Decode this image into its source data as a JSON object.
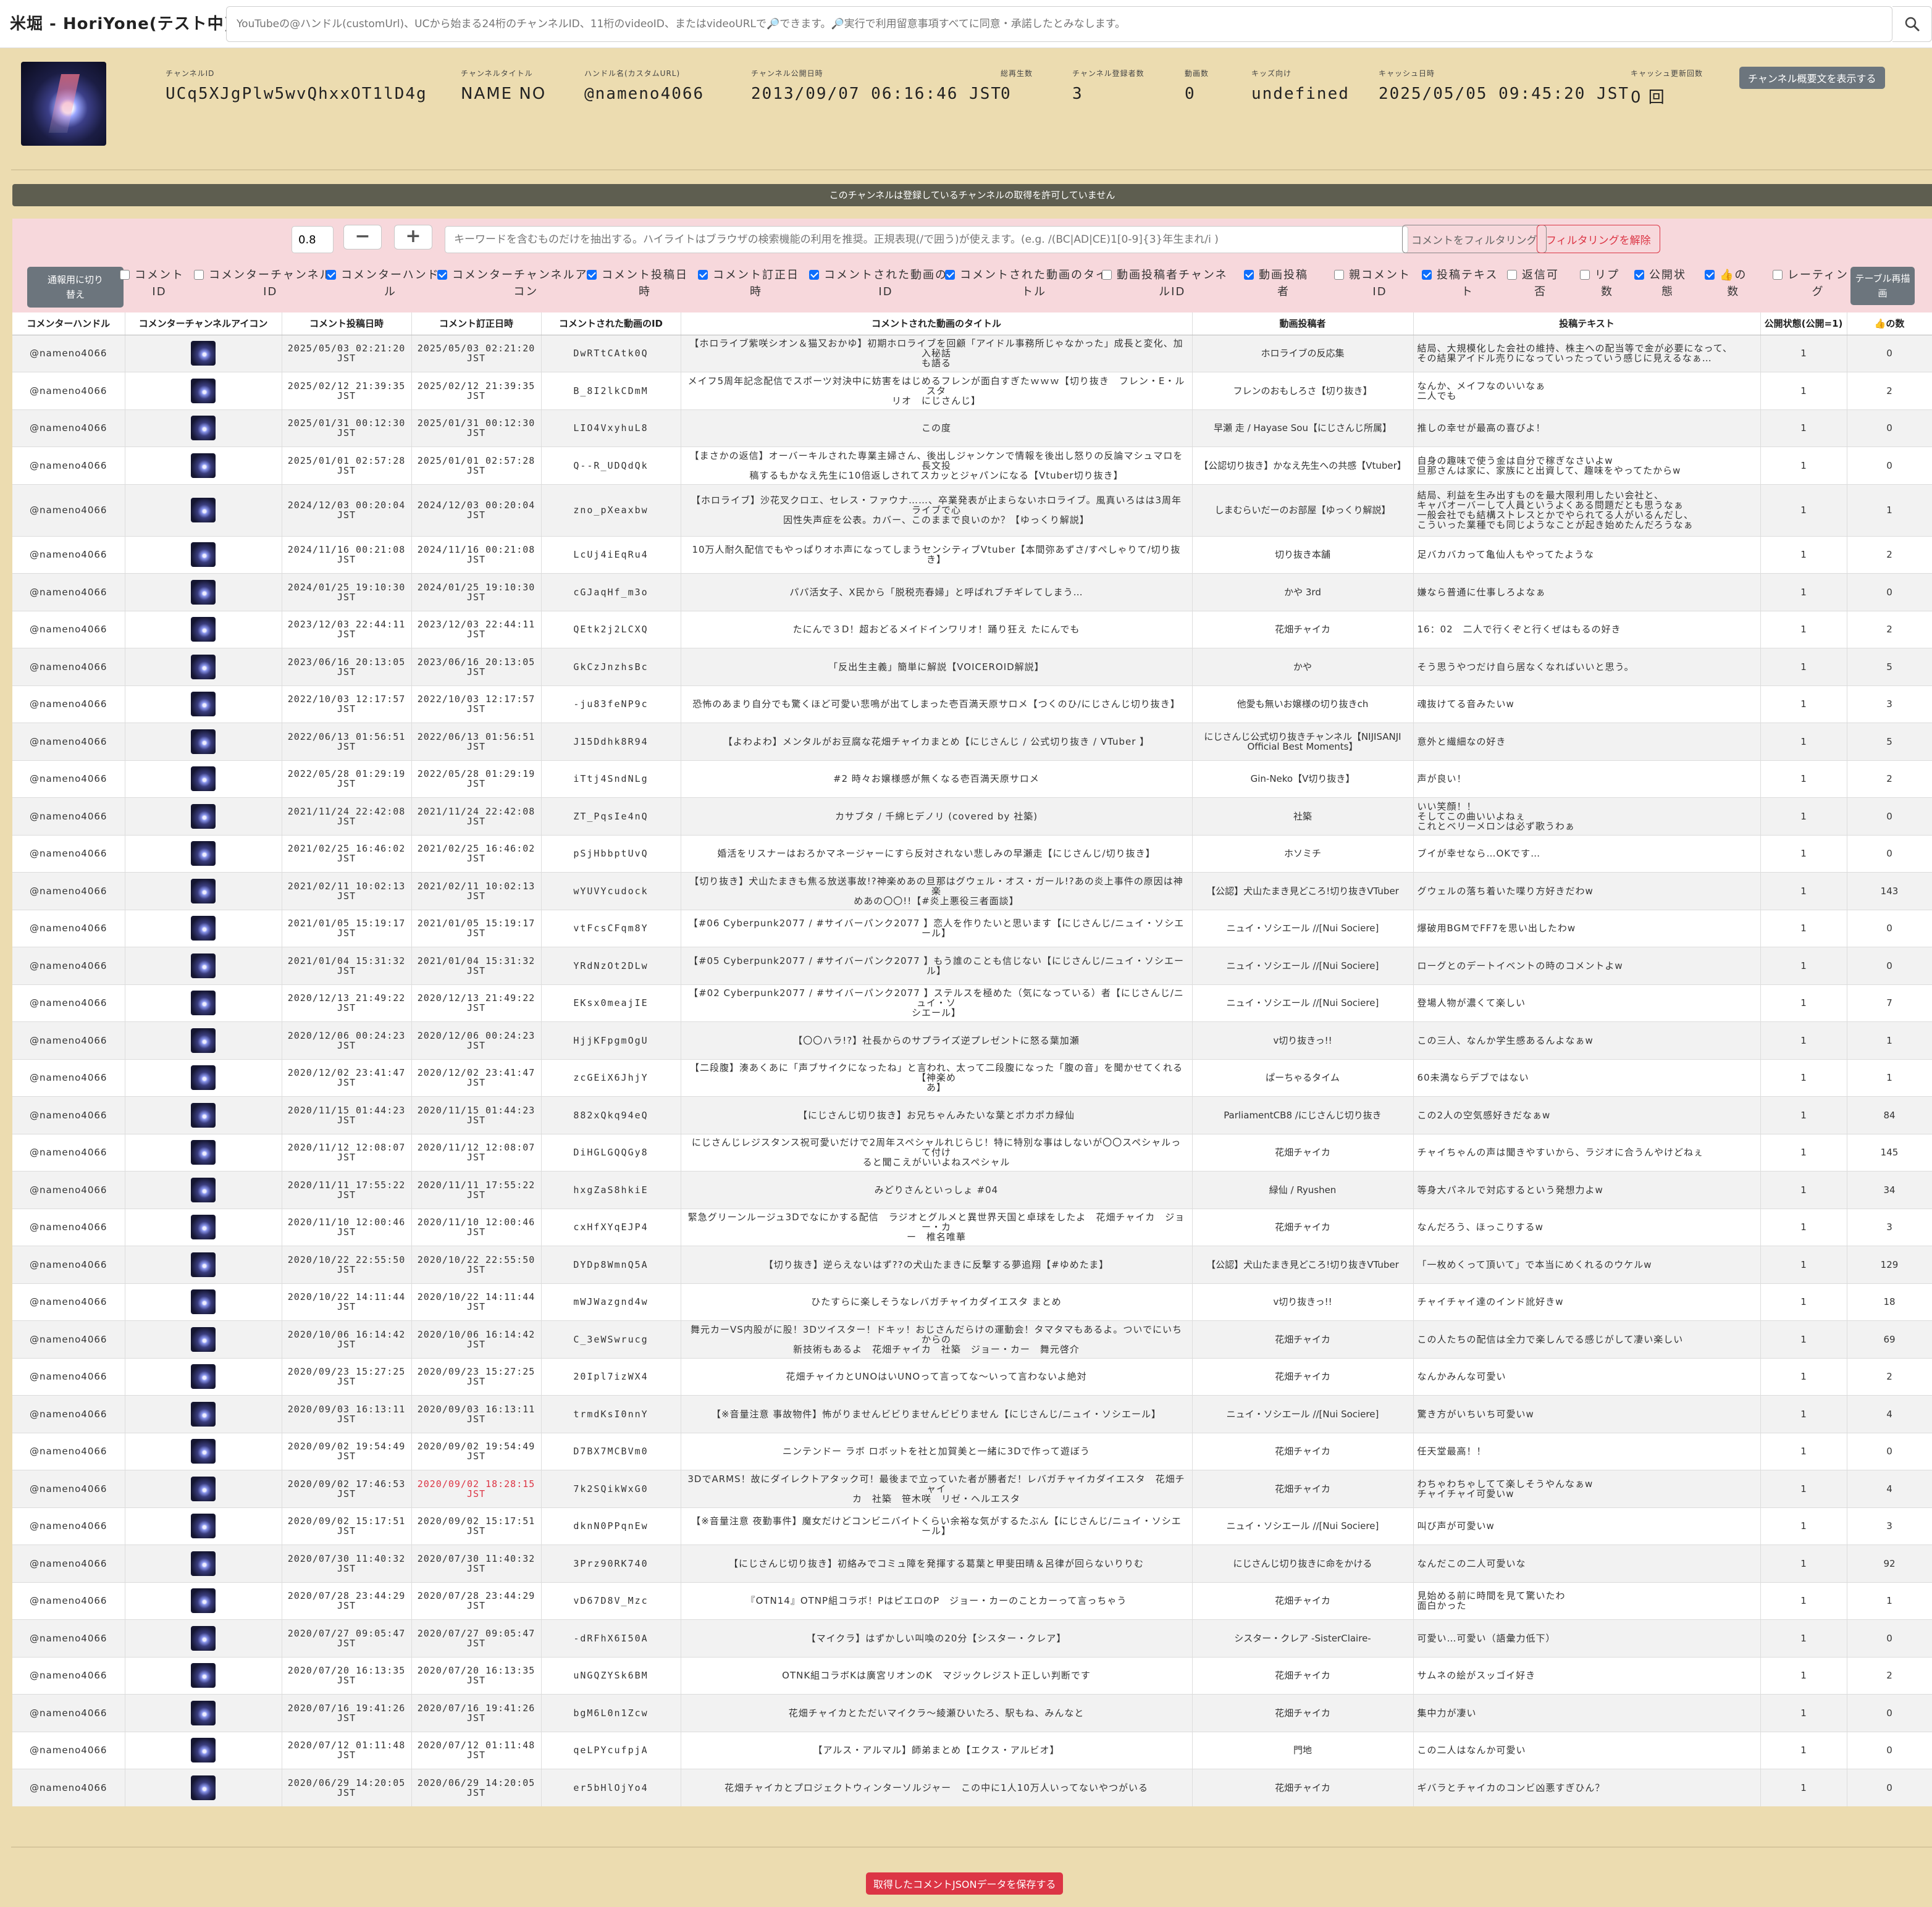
{
  "app": {
    "title": "米堀 - HoriYone(テスト中)"
  },
  "search": {
    "placeholder": "YouTubeの@ハンドル(customUrl)、UCから始まる24桁のチャンネルID、11桁のvideoID、またはvideoURLで🔎できます。🔎実行で利用留意事項すべてに同意・承諾したとみなします。",
    "button_icon": "search-icon"
  },
  "channel": {
    "fields": [
      {
        "label": "チャンネルID",
        "value": "UCq5XJgPlw5wvQhxxOT1lD4g"
      },
      {
        "label": "チャンネルタイトル",
        "value": "NAME NO"
      },
      {
        "label": "ハンドル名(カスタムURL)",
        "value": "@nameno4066"
      },
      {
        "label": "チャンネル公開日時",
        "value": "2013/09/07 06:16:46 JST"
      },
      {
        "label": "総再生数",
        "value": "0"
      },
      {
        "label": "チャンネル登録者数",
        "value": "3"
      },
      {
        "label": "動画数",
        "value": "0"
      },
      {
        "label": "キッズ向け",
        "value": "undefined"
      },
      {
        "label": "キャッシュ日時",
        "value": "2025/05/05 09:45:20 JST"
      },
      {
        "label": "キャッシュ更新回数",
        "value": "0 回"
      }
    ],
    "desc_button": "チャンネル概要文を表示する"
  },
  "notice": "このチャンネルは登録しているチャンネルの取得を許可していません",
  "filter": {
    "zoom_value": "0.8",
    "minus": "−",
    "plus": "+",
    "keyword_placeholder": "キーワードを含むものだけを抽出する。ハイライトはブラウザの検索機能の利用を推奨。正規表現(/で囲う)が使えます。(e.g. /(BC|AD|CE)1[0-9]{3}年生まれ/i )",
    "filter_button": "コメントをフィルタリング",
    "clear_button": "フィルタリングを解除",
    "toggle_button": "通報用に切り\n替え",
    "redraw_button": "テーブル再描\n画",
    "columns": [
      {
        "label": "コメント\nID",
        "checked": false
      },
      {
        "label": "コメンターチャンネル\nID",
        "checked": false
      },
      {
        "label": "コメンターハンド\nル",
        "checked": true
      },
      {
        "label": "コメンターチャンネルアイ\nコン",
        "checked": true
      },
      {
        "label": "コメント投稿日\n時",
        "checked": true
      },
      {
        "label": "コメント訂正日\n時",
        "checked": true
      },
      {
        "label": "コメントされた動画の\nID",
        "checked": true
      },
      {
        "label": "コメントされた動画のタイ\nトル",
        "checked": true
      },
      {
        "label": "動画投稿者チャンネ\nルID",
        "checked": false
      },
      {
        "label": "動画投稿\n者",
        "checked": true
      },
      {
        "label": "親コメント\nID",
        "checked": false
      },
      {
        "label": "投稿テキス\nト",
        "checked": true
      },
      {
        "label": "返信可\n否",
        "checked": false
      },
      {
        "label": "リプ\n数",
        "checked": false
      },
      {
        "label": "公開状\n態",
        "checked": true
      },
      {
        "label": "👍の\n数",
        "checked": true
      },
      {
        "label": "レーティン\nグ",
        "checked": false
      }
    ]
  },
  "table": {
    "headers": [
      "コメンターハンドル",
      "コメンターチャンネルアイコン",
      "コメント投稿日時",
      "コメント訂正日時",
      "コメントされた動画のID",
      "コメントされた動画のタイトル",
      "動画投稿者",
      "投稿テキスト",
      "公開状態(公開=1)",
      "👍の数"
    ],
    "handle": "@nameno4066",
    "rows": [
      {
        "posted": "2025/05/03 02:21:20\nJST",
        "edited": "2025/05/03 02:21:20\nJST",
        "vid": "DwRTtCAtk0Q",
        "title": "【ホロライブ紫咲シオン＆猫又おかゆ】初期ホロライブを回顧「アイドル事務所じゃなかった」成長と変化、加入秘話\nも語る",
        "uploader": "ホロライブの反応集",
        "text": "結局、大規模化した会社の維持、株主への配当等で金が必要になって、\nその結果アイドル売りになっていったっていう感じに見えるなぁ…",
        "status": "1",
        "likes": "0"
      },
      {
        "posted": "2025/02/12 21:39:35\nJST",
        "edited": "2025/02/12 21:39:35\nJST",
        "vid": "B_8I2lkCDmM",
        "title": "メイフ5周年記念配信でスポーツ対決中に妨害をはじめるフレンが面白すぎたｗｗｗ【切り抜き　フレン・E・ルスタ\nリオ　にじさんじ】",
        "uploader": "フレンのおもしろさ【切り抜き】",
        "text": "なんか、メイフなのいいなぁ\n二人でも",
        "status": "1",
        "likes": "2"
      },
      {
        "posted": "2025/01/31 00:12:30\nJST",
        "edited": "2025/01/31 00:12:30\nJST",
        "vid": "LIO4VxyhuL8",
        "title": "この度",
        "uploader": "早瀬 走 / Hayase Sou【にじさんじ所属】",
        "text": "推しの幸せが最高の喜びよ！",
        "status": "1",
        "likes": "0"
      },
      {
        "posted": "2025/01/01 02:57:28\nJST",
        "edited": "2025/01/01 02:57:28\nJST",
        "vid": "Q--R_UDQdQk",
        "title": "【まさかの返信】オーバーキルされた専業主婦さん、後出しジャンケンで情報を後出し怒りの反論マシュマロを長文投\n稿するもかなえ先生に10倍返しされてスカッとジャパンになる【Vtuber切り抜き】",
        "uploader": "【公認切り抜き】かなえ先生への共感【Vtuber】",
        "text": "自身の趣味で使う金は自分で稼ぎなさいよw\n旦那さんは家に、家族にと出資して、趣味をやってたからw",
        "status": "1",
        "likes": "0"
      },
      {
        "posted": "2024/12/03 00:20:04\nJST",
        "edited": "2024/12/03 00:20:04\nJST",
        "vid": "zno_pXeaxbw",
        "title": "【ホロライブ】沙花叉クロエ、セレス・ファウナ……、卒業発表が止まらないホロライブ。風真いろはは3周年ライブで心\n因性失声症を公表。カバー、このままで良いのか？【ゆっくり解説】",
        "uploader": "しまむらいだーのお部屋【ゆっくり解説】",
        "text": "結局、利益を生み出すものを最大限利用したい会社と、\nキャパオーバーして人員というよくある問題だとも思うなぁ\n一般会社でも結構ストレスとかでやられてる人がいるんだし、\nこういった業種でも同じようなことが起き始めたんだろうなぁ",
        "status": "1",
        "likes": "1"
      },
      {
        "posted": "2024/11/16 00:21:08\nJST",
        "edited": "2024/11/16 00:21:08\nJST",
        "vid": "LcUj4iEqRu4",
        "title": "10万人耐久配信でもやっぱりオホ声になってしまうセンシティブVtuber【本間弥あずさ/すぺしゃりて/切り抜き】",
        "uploader": "切り抜き本舗",
        "text": "足バカバカって亀仙人もやってたような",
        "status": "1",
        "likes": "2"
      },
      {
        "posted": "2024/01/25 19:10:30\nJST",
        "edited": "2024/01/25 19:10:30\nJST",
        "vid": "cGJaqHf_m3o",
        "title": "パパ活女子、X民から「脱税売春婦」と呼ばれブチギレてしまう…",
        "uploader": "かや 3rd",
        "text": "嫌なら普通に仕事しろよなぁ",
        "status": "1",
        "likes": "0"
      },
      {
        "posted": "2023/12/03 22:44:11\nJST",
        "edited": "2023/12/03 22:44:11\nJST",
        "vid": "QEtk2j2LCXQ",
        "title": "たにんで３D！超おどるメイドインワリオ！踊り狂え たにんでも",
        "uploader": "花畑チャイカ",
        "text": "16：02　二人で行くぞと行くぜはもるの好き",
        "status": "1",
        "likes": "2"
      },
      {
        "posted": "2023/06/16 20:13:05\nJST",
        "edited": "2023/06/16 20:13:05\nJST",
        "vid": "GkCzJnzhsBc",
        "title": "「反出生主義」簡単に解説【VOICEROID解説】",
        "uploader": "かや",
        "text": "そう思うやつだけ自ら居なくなればいいと思う。",
        "status": "1",
        "likes": "5"
      },
      {
        "posted": "2022/10/03 12:17:57\nJST",
        "edited": "2022/10/03 12:17:57\nJST",
        "vid": "-ju83feNP9c",
        "title": "恐怖のあまり自分でも驚くほど可愛い悲鳴が出てしまった壱百満天原サロメ【つくのひ/にじさんじ切り抜き】",
        "uploader": "他愛も無いお嬢様の切り抜きch",
        "text": "魂抜けてる音みたいw",
        "status": "1",
        "likes": "3"
      },
      {
        "posted": "2022/06/13 01:56:51\nJST",
        "edited": "2022/06/13 01:56:51\nJST",
        "vid": "J15Ddhk8R94",
        "title": "【よわよわ】メンタルがお豆腐な花畑チャイカまとめ【にじさんじ / 公式切り抜き / VTuber 】",
        "uploader": "にじさんじ公式切り抜きチャンネル【NIJISANJI\nOfficial Best Moments】",
        "text": "意外と繊細なの好き",
        "status": "1",
        "likes": "5"
      },
      {
        "posted": "2022/05/28 01:29:19\nJST",
        "edited": "2022/05/28 01:29:19\nJST",
        "vid": "iTtj4SndNLg",
        "title": "#2 時々お嬢様感が無くなる壱百満天原サロメ",
        "uploader": "Gin-Neko【V切り抜き】",
        "text": "声が良い！",
        "status": "1",
        "likes": "2"
      },
      {
        "posted": "2021/11/24 22:42:08\nJST",
        "edited": "2021/11/24 22:42:08\nJST",
        "vid": "ZT_PqsIe4nQ",
        "title": "カサブタ / 千綿ヒデノリ (covered by 社築)",
        "uploader": "社築",
        "text": "いい笑顔！！\nそしてこの曲いいよねぇ\nこれとベリーメロンは必ず歌うわぁ",
        "status": "1",
        "likes": "0"
      },
      {
        "posted": "2021/02/25 16:46:02\nJST",
        "edited": "2021/02/25 16:46:02\nJST",
        "vid": "pSjHbbptUvQ",
        "title": "婚活をリスナーはおろかマネージャーにすら反対されない悲しみの早瀬走【にじさんじ/切り抜き】",
        "uploader": "ホソミチ",
        "text": "ブイが幸せなら…OKです…",
        "status": "1",
        "likes": "0"
      },
      {
        "posted": "2021/02/11 10:02:13\nJST",
        "edited": "2021/02/11 10:02:13\nJST",
        "vid": "wYUVYcudock",
        "title": "【切り抜き】犬山たまきも焦る放送事故!?神楽めあの旦那はグウェル・オス・ガール!?あの炎上事件の原因は神楽\nめあの〇〇!!【#炎上悪役三者面談】",
        "uploader": "【公認】犬山たまき見どころ!切り抜きVTuber",
        "text": "グウェルの落ち着いた喋り方好きだわw",
        "status": "1",
        "likes": "143"
      },
      {
        "posted": "2021/01/05 15:19:17\nJST",
        "edited": "2021/01/05 15:19:17\nJST",
        "vid": "vtFcsCFqm8Y",
        "title": "【#06 Cyberpunk2077 / #サイバーパンク2077 】恋人を作りたいと思います【にじさんじ/ニュイ・ソシエール】",
        "uploader": "ニュイ・ソシエール //[Nui Sociere]",
        "text": "爆破用BGMでFF7を思い出したわw",
        "status": "1",
        "likes": "0"
      },
      {
        "posted": "2021/01/04 15:31:32\nJST",
        "edited": "2021/01/04 15:31:32\nJST",
        "vid": "YRdNzOt2DLw",
        "title": "【#05 Cyberpunk2077 / #サイバーパンク2077 】もう誰のことも信じない【にじさんじ/ニュイ・ソシエール】",
        "uploader": "ニュイ・ソシエール //[Nui Sociere]",
        "text": "ローグとのデートイベントの時のコメントよw",
        "status": "1",
        "likes": "0"
      },
      {
        "posted": "2020/12/13 21:49:22\nJST",
        "edited": "2020/12/13 21:49:22\nJST",
        "vid": "EKsx0meajIE",
        "title": "【#02 Cyberpunk2077 / #サイバーパンク2077 】ステルスを極めた（気になっている）者【にじさんじ/ニュイ・ソ\nシエール】",
        "uploader": "ニュイ・ソシエール //[Nui Sociere]",
        "text": "登場人物が濃くて楽しい",
        "status": "1",
        "likes": "7"
      },
      {
        "posted": "2020/12/06 00:24:23\nJST",
        "edited": "2020/12/06 00:24:23\nJST",
        "vid": "HjjKFpgmOgU",
        "title": "【〇〇ハラ!?】社長からのサプライズ逆プレゼントに怒る葉加瀬",
        "uploader": "v切り抜きっ!!",
        "text": "この三人、なんか学生感あるんよなぁw",
        "status": "1",
        "likes": "1"
      },
      {
        "posted": "2020/12/02 23:41:47\nJST",
        "edited": "2020/12/02 23:41:47\nJST",
        "vid": "zcGEiX6JhjY",
        "title": "【二段腹】湊あくあに「声ブサイクになったね」と言われ、太って二段腹になった「腹の音」を聞かせてくれる【神楽め\nあ】",
        "uploader": "ぱーちゃるタイム",
        "text": "60未満ならデブではない",
        "status": "1",
        "likes": "1"
      },
      {
        "posted": "2020/11/15 01:44:23\nJST",
        "edited": "2020/11/15 01:44:23\nJST",
        "vid": "882xQkq94eQ",
        "title": "【にじさんじ切り抜き】お兄ちゃんみたいな葉とポカポカ緑仙",
        "uploader": "ParliamentCB8 /にじさんじ切り抜き",
        "text": "この2人の空気感好きだなぁw",
        "status": "1",
        "likes": "84"
      },
      {
        "posted": "2020/11/12 12:08:07\nJST",
        "edited": "2020/11/12 12:08:07\nJST",
        "vid": "DiHGLGQQGy8",
        "title": "にじさんじレジスタンス祝可愛いだけで2周年スペシャルれじらじ！特に特別な事はしないが〇〇スペシャルって付け\nると聞こえがいいよねスペシャル",
        "uploader": "花畑チャイカ",
        "text": "チャイちゃんの声は聞きやすいから、ラジオに合うんやけどねぇ",
        "status": "1",
        "likes": "145"
      },
      {
        "posted": "2020/11/11 17:55:22\nJST",
        "edited": "2020/11/11 17:55:22\nJST",
        "vid": "hxgZaS8hkiE",
        "title": "みどりさんといっしょ #04",
        "uploader": "緑仙 / Ryushen",
        "text": "等身大パネルで対応するという発想力よw",
        "status": "1",
        "likes": "34"
      },
      {
        "posted": "2020/11/10 12:00:46\nJST",
        "edited": "2020/11/10 12:00:46\nJST",
        "vid": "cxHfXYqEJP4",
        "title": "緊急グリーンルージュ3Dでなにかする配信　ラジオとグルメと異世界天国と卓球をしたよ　花畑チャイカ　ジョー・カ\nー　椎名唯華",
        "uploader": "花畑チャイカ",
        "text": "なんだろう、ほっこりするw",
        "status": "1",
        "likes": "3"
      },
      {
        "posted": "2020/10/22 22:55:50\nJST",
        "edited": "2020/10/22 22:55:50\nJST",
        "vid": "DYDp8WmnQ5A",
        "title": "【切り抜き】逆らえないはず??の犬山たまきに反撃する夢追翔【#ゆめたま】",
        "uploader": "【公認】犬山たまき見どころ!切り抜きVTuber",
        "text": "「一枚めくって頂いて」で本当にめくれるのウケルw",
        "status": "1",
        "likes": "129"
      },
      {
        "posted": "2020/10/22 14:11:44\nJST",
        "edited": "2020/10/22 14:11:44\nJST",
        "vid": "mWJWazgnd4w",
        "title": "ひたすらに楽しそうなレバガチャイカダイエスタ まとめ",
        "uploader": "v切り抜きっ!!",
        "text": "チャイチャイ達のインド訛好きw",
        "status": "1",
        "likes": "18"
      },
      {
        "posted": "2020/10/06 16:14:42\nJST",
        "edited": "2020/10/06 16:14:42\nJST",
        "vid": "C_3eWSwrucg",
        "title": "舞元カーVS内股がに股！3Dツイスター！ドキッ！おじさんだらけの運動会！タマタマもあるよ。ついでにいちからの\n新技術もあるよ　花畑チャイカ　社築　ジョー・カー　舞元啓介",
        "uploader": "花畑チャイカ",
        "text": "この人たちの配信は全力で楽しんでる感じがして凄い楽しい",
        "status": "1",
        "likes": "69"
      },
      {
        "posted": "2020/09/23 15:27:25\nJST",
        "edited": "2020/09/23 15:27:25\nJST",
        "vid": "20Ipl7izWX4",
        "title": "花畑チャイカとUNOはいUNOって言ってな～いって言わないよ絶対",
        "uploader": "花畑チャイカ",
        "text": "なんかみんな可愛い",
        "status": "1",
        "likes": "2"
      },
      {
        "posted": "2020/09/03 16:13:11\nJST",
        "edited": "2020/09/03 16:13:11\nJST",
        "vid": "trmdKsI0nnY",
        "title": "【※音量注意 事故物件】怖がりませんビビりませんビビりません【にじさんじ/ニュイ・ソシエール】",
        "uploader": "ニュイ・ソシエール //[Nui Sociere]",
        "text": "驚き方がいちいち可愛いw",
        "status": "1",
        "likes": "4"
      },
      {
        "posted": "2020/09/02 19:54:49\nJST",
        "edited": "2020/09/02 19:54:49\nJST",
        "vid": "D7BX7MCBVm0",
        "title": "ニンテンドー ラボ ロボットを社と加賀美と一緒に3Dで作って遊ぼう",
        "uploader": "花畑チャイカ",
        "text": "任天堂最高！！",
        "status": "1",
        "likes": "0"
      },
      {
        "posted": "2020/09/02 17:46:53\nJST",
        "edited": "2020/09/02 18:28:15\nJST",
        "edited_red": true,
        "vid": "7k2SQikWxG0",
        "title": "3DでARMS！故にダイレクトアタック可！最後まで立っていた者が勝者だ！レバガチャイカダイエスタ　花畑チャイ\nカ　社築　笹木咲　リゼ・ヘルエスタ",
        "uploader": "花畑チャイカ",
        "text": "わちゃわちゃしてて楽しそうやんなぁw\nチャイチャイ可愛いw",
        "status": "1",
        "likes": "4"
      },
      {
        "posted": "2020/09/02 15:17:51\nJST",
        "edited": "2020/09/02 15:17:51\nJST",
        "vid": "dknN0PPqnEw",
        "title": "【※音量注意 夜勤事件】魔女だけどコンビニバイトくらい余裕な気がするたぶん【にじさんじ/ニュイ・ソシエール】",
        "uploader": "ニュイ・ソシエール //[Nui Sociere]",
        "text": "叫び声が可愛いw",
        "status": "1",
        "likes": "3"
      },
      {
        "posted": "2020/07/30 11:40:32\nJST",
        "edited": "2020/07/30 11:40:32\nJST",
        "vid": "3Prz90RK740",
        "title": "【にじさんじ切り抜き】初絡みでコミュ障を発揮する葛葉と甲斐田晴＆呂律が回らないりりむ",
        "uploader": "にじさんじ切り抜きに命をかける",
        "text": "なんだこの二人可愛いな",
        "status": "1",
        "likes": "92"
      },
      {
        "posted": "2020/07/28 23:44:29\nJST",
        "edited": "2020/07/28 23:44:29\nJST",
        "vid": "vD67D8V_Mzc",
        "title": "『OTN14』OTNP組コラボ！PはピエロのP　ジョー・カーのことカーって言っちゃう",
        "uploader": "花畑チャイカ",
        "text": "見始める前に時間を見て驚いたわ\n面白かった",
        "status": "1",
        "likes": "1"
      },
      {
        "posted": "2020/07/27 09:05:47\nJST",
        "edited": "2020/07/27 09:05:47\nJST",
        "vid": "-dRFhX6I50A",
        "title": "【マイクラ】はずかしい叫喚の20分【シスター・クレア】",
        "uploader": "シスター・クレア -SisterClaire-",
        "text": "可愛い…可愛い（語彙力低下）",
        "status": "1",
        "likes": "0"
      },
      {
        "posted": "2020/07/20 16:13:35\nJST",
        "edited": "2020/07/20 16:13:35\nJST",
        "vid": "uNGQZYSk6BM",
        "title": "OTNK組コラボKは廣宮リオンのK　マジックレジスト正しい判断です",
        "uploader": "花畑チャイカ",
        "text": "サムネの絵がスッゴイ好き",
        "status": "1",
        "likes": "2"
      },
      {
        "posted": "2020/07/16 19:41:26\nJST",
        "edited": "2020/07/16 19:41:26\nJST",
        "vid": "bgM6L0n1Zcw",
        "title": "花畑チャイカとただいマイクラ～綾瀬ひいたろ、駅もね、みんなと",
        "uploader": "花畑チャイカ",
        "text": "集中力が凄い",
        "status": "1",
        "likes": "0"
      },
      {
        "posted": "2020/07/12 01:11:48\nJST",
        "edited": "2020/07/12 01:11:48\nJST",
        "vid": "qeLPYcufpjA",
        "title": "【アルス・アルマル】師弟まとめ【エクス・アルビオ】",
        "uploader": "門地",
        "text": "この二人はなんか可愛い",
        "status": "1",
        "likes": "0"
      },
      {
        "posted": "2020/06/29 14:20:05\nJST",
        "edited": "2020/06/29 14:20:05\nJST",
        "vid": "er5bHlOjYo4",
        "title": "花畑チャイカとプロジェクトウィンターソルジャー　この中に1人10万人いってないやつがいる",
        "uploader": "花畑チャイカ",
        "text": "ギバラとチャイカのコンビ凶悪すぎひん？",
        "status": "1",
        "likes": "0"
      }
    ]
  },
  "footer": {
    "save_button": "取得したコメントJSONデータを保存する"
  },
  "colors": {
    "background": "#ecdcb0",
    "accent_red": "#dc3545",
    "secondary": "#6c757d",
    "filter_bg": "#f7d8dc",
    "checkbox_blue": "#0d6efd"
  }
}
